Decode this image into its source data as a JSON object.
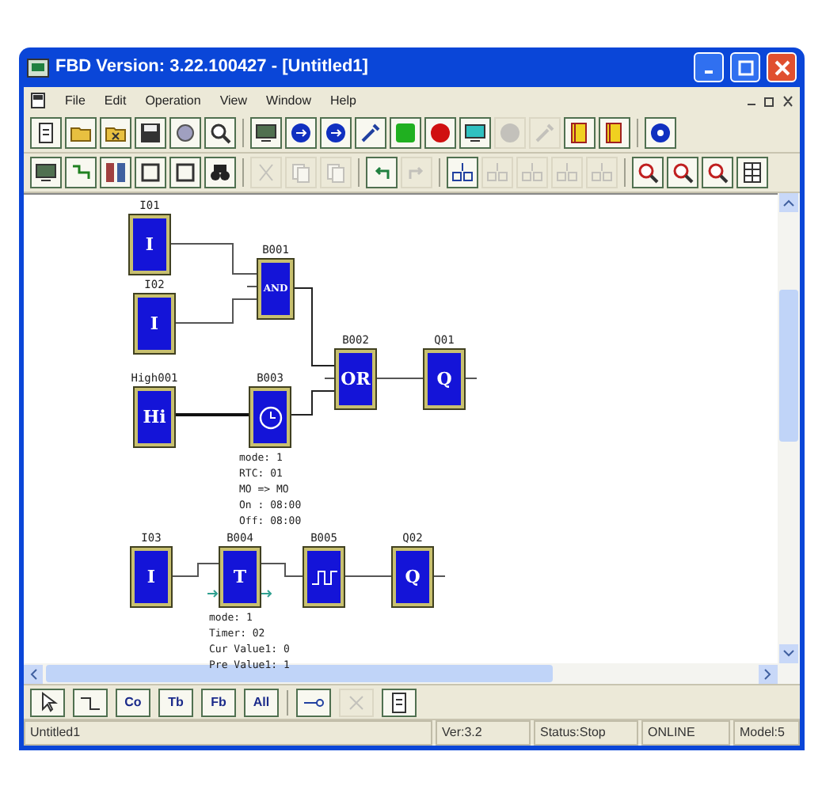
{
  "window": {
    "title": "FBD Version: 3.22.100427 - [Untitled1]"
  },
  "menu": [
    "File",
    "Edit",
    "Operation",
    "View",
    "Window",
    "Help"
  ],
  "toolbar_1": [
    [
      {
        "kind": "new",
        "disabled": false
      },
      {
        "kind": "open",
        "disabled": false
      },
      {
        "kind": "close",
        "disabled": false
      },
      {
        "kind": "save",
        "disabled": false
      },
      {
        "kind": "print",
        "disabled": false
      },
      {
        "kind": "preview",
        "disabled": false
      }
    ],
    [
      {
        "kind": "monitor",
        "disabled": false
      },
      {
        "kind": "read",
        "disabled": false
      },
      {
        "kind": "write",
        "disabled": false
      },
      {
        "kind": "wrench",
        "disabled": false
      },
      {
        "kind": "run",
        "disabled": false
      },
      {
        "kind": "stop",
        "disabled": false
      },
      {
        "kind": "simulate",
        "disabled": false
      },
      {
        "kind": "pause",
        "disabled": true
      },
      {
        "kind": "wrench",
        "disabled": true
      },
      {
        "kind": "book",
        "disabled": false
      },
      {
        "kind": "book",
        "disabled": false
      }
    ],
    [
      {
        "kind": "help",
        "disabled": false
      }
    ]
  ],
  "toolbar_2": [
    [
      {
        "kind": "monitor",
        "disabled": false
      },
      {
        "kind": "flow",
        "disabled": false
      },
      {
        "kind": "split",
        "disabled": false
      },
      {
        "kind": "frame",
        "disabled": false
      },
      {
        "kind": "frame",
        "disabled": false
      },
      {
        "kind": "binoculars",
        "disabled": false
      }
    ],
    [
      {
        "kind": "cut",
        "disabled": true
      },
      {
        "kind": "copy",
        "disabled": true
      },
      {
        "kind": "paste",
        "disabled": true
      }
    ],
    [
      {
        "kind": "undo",
        "disabled": false
      },
      {
        "kind": "redo",
        "disabled": true
      }
    ],
    [
      {
        "kind": "align",
        "disabled": false
      },
      {
        "kind": "align",
        "disabled": true
      },
      {
        "kind": "align",
        "disabled": true
      },
      {
        "kind": "align",
        "disabled": true
      },
      {
        "kind": "align",
        "disabled": true
      }
    ],
    [
      {
        "kind": "zoom",
        "disabled": false
      },
      {
        "kind": "zoom",
        "disabled": false
      },
      {
        "kind": "zoom",
        "disabled": false
      },
      {
        "kind": "grid",
        "disabled": false
      }
    ]
  ],
  "blocks": [
    {
      "label": "I01",
      "kind": "text",
      "symbol": "I"
    },
    {
      "label": "I02",
      "kind": "text",
      "symbol": "I"
    },
    {
      "label": "B001",
      "kind": "text",
      "symbol": "AND"
    },
    {
      "label": "High001",
      "kind": "text",
      "symbol": "Hi"
    },
    {
      "label": "B003",
      "kind": "clock",
      "params": [
        "mode: 1",
        "RTC: 01",
        "MO => MO",
        "On : 08:00",
        "Off: 08:00"
      ]
    },
    {
      "label": "B002",
      "kind": "text",
      "symbol": "OR"
    },
    {
      "label": "Q01",
      "kind": "text",
      "symbol": "Q"
    },
    {
      "label": "I03",
      "kind": "text",
      "symbol": "I"
    },
    {
      "label": "B004",
      "kind": "timer",
      "symbol": "T",
      "params": [
        "mode: 1",
        "Timer: 02",
        "Cur Value1: 0",
        "Pre Value1: 1"
      ]
    },
    {
      "label": "B005",
      "kind": "pulse"
    },
    {
      "label": "Q02",
      "kind": "text",
      "symbol": "Q"
    }
  ],
  "bottom_toolbar": [
    [
      {
        "kind": "pointer",
        "disabled": false
      },
      {
        "kind": "wire",
        "disabled": false
      },
      {
        "kind": "text",
        "label": "Co",
        "disabled": false
      },
      {
        "kind": "text",
        "label": "Tb",
        "disabled": false
      },
      {
        "kind": "text",
        "label": "Fb",
        "disabled": false
      },
      {
        "kind": "text",
        "label": "All",
        "disabled": false
      }
    ],
    [
      {
        "kind": "link",
        "disabled": false
      },
      {
        "kind": "delete",
        "disabled": true
      },
      {
        "kind": "page",
        "disabled": false
      }
    ]
  ],
  "status_bar": [
    "Untitled1",
    "Ver:3.2",
    "Status:Stop",
    "ONLINE",
    "Model:5"
  ]
}
